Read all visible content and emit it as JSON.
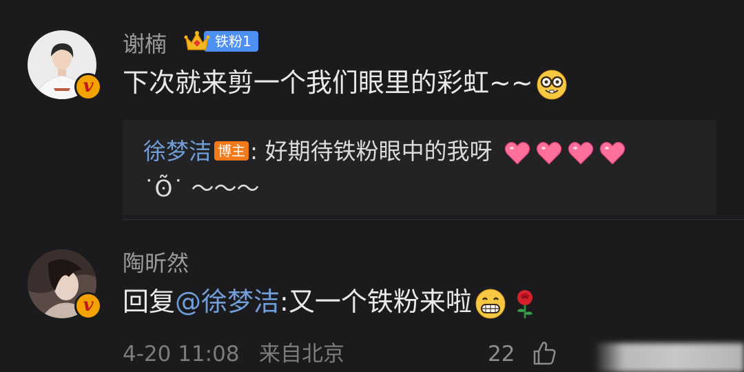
{
  "comments": [
    {
      "author": "谢楠",
      "fan_badge": "铁粉1",
      "text": "下次就来剪一个我们眼里的彩虹~~",
      "emoji": "nerd-face-emoji",
      "quoted_reply": {
        "author": "徐梦洁",
        "role_tag": "博主",
        "text_line1": ": 好期待铁粉眼中的我呀",
        "hearts": [
          "heart-emoji",
          "heart-emoji",
          "heart-emoji",
          "heart-emoji"
        ],
        "text_line2": "˙ʘ̃˙ ～～～"
      }
    },
    {
      "author": "陶昕然",
      "reply_prefix": "回复",
      "mention": "@徐梦洁",
      "text": ":又一个铁粉来啦",
      "emoji": [
        "grin-emoji",
        "rose-emoji"
      ]
    }
  ],
  "footer": {
    "timestamp": "4-20 11:08",
    "location": "来自北京",
    "likes": "22",
    "like_icon": "thumbs-up-icon"
  },
  "colors": {
    "background": "#1b1b1d",
    "link_blue": "#6f9ed8",
    "fan_badge_blue": "#4d8ff2",
    "blogger_orange": "#f27a1a",
    "verified_gold": "#f2a300"
  }
}
